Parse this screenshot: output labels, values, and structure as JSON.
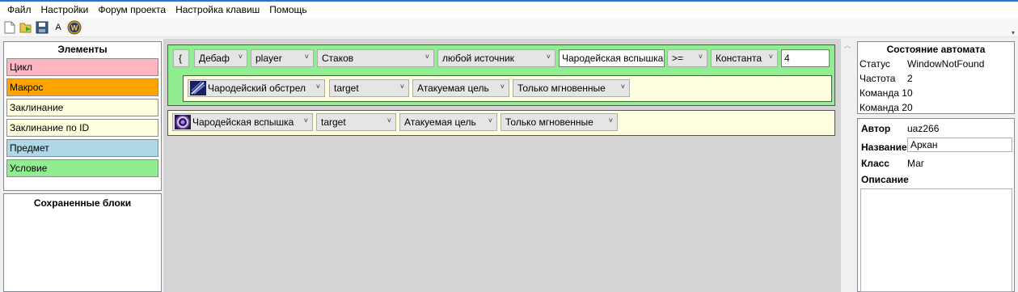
{
  "menu": {
    "items": [
      "Файл",
      "Настройки",
      "Форум проекта",
      "Настройка клавиш",
      "Помощь"
    ]
  },
  "toolbar": {
    "font_label": "A",
    "wow_label": "W"
  },
  "elements_panel": {
    "title": "Элементы",
    "items": [
      {
        "label": "Цикл",
        "color": "#ffb6c1"
      },
      {
        "label": "Макрос",
        "color": "#ffa500"
      },
      {
        "label": "Заклинание",
        "color": "#ffffe0"
      },
      {
        "label": "Заклинание по ID",
        "color": "#ffffe0"
      },
      {
        "label": "Предмет",
        "color": "#add8e6"
      },
      {
        "label": "Условие",
        "color": "#90ee90"
      }
    ]
  },
  "saved_panel": {
    "title": "Сохраненные блоки"
  },
  "condition_block": {
    "bracket": "{",
    "type": "Дебаф",
    "unit": "player",
    "property": "Стаков",
    "source": "любой источник",
    "aura": "Чародейская вспышка",
    "operator": ">=",
    "value_type": "Константа",
    "value": "4",
    "inner_spell": {
      "name": "Чародейский обстрел",
      "target": "target",
      "target_mode": "Атакуемая цель",
      "cast_mode": "Только мгновенные"
    }
  },
  "spell_block": {
    "name": "Чародейская вспышка",
    "target": "target",
    "target_mode": "Атакуемая цель",
    "cast_mode": "Только мгновенные"
  },
  "status_panel": {
    "title": "Состояние автомата",
    "status_label": "Статус",
    "status_value": "WindowNotFound",
    "freq_label": "Частота",
    "freq_value": "2",
    "cmd1_label": "Команда 1",
    "cmd1_value": "0",
    "cmd2_label": "Команда 2",
    "cmd2_value": "0"
  },
  "info_panel": {
    "author_label": "Автор",
    "author_value": "uaz266",
    "name_label": "Название",
    "name_value": "Аркан",
    "class_label": "Класс",
    "class_value": "Маг",
    "desc_label": "Описание",
    "desc_value": ""
  },
  "colors": {
    "condition_bg": "#90ee90",
    "spell_bg": "#ffffe0",
    "canvas_bg": "#d4d4d4",
    "accent": "#1e7ad6"
  },
  "icons": [
    "new-file-icon",
    "open-icon",
    "save-icon",
    "font-icon",
    "wow-icon",
    "arcane-barrage-icon",
    "arcane-blast-icon"
  ]
}
